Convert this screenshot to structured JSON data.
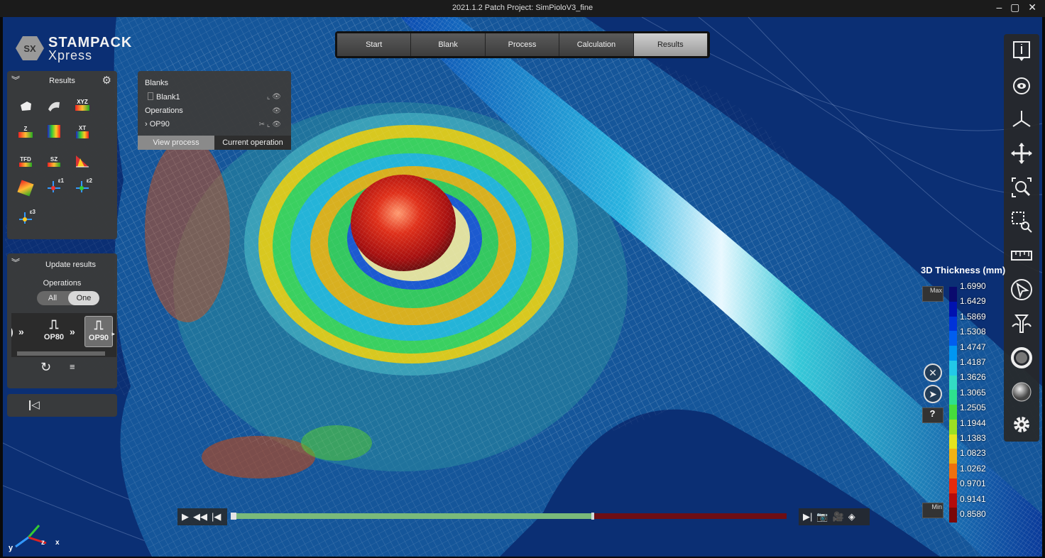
{
  "window": {
    "title": "2021.1.2 Patch  Project: SimPioloV3_fine",
    "controls": "– ▢ ✕"
  },
  "logo": {
    "badge": "SX",
    "line1": "STAMPACK",
    "line2": "Xpress"
  },
  "tabs": [
    {
      "label": "Start",
      "active": false
    },
    {
      "label": "Blank",
      "active": false
    },
    {
      "label": "Process",
      "active": false
    },
    {
      "label": "Calculation",
      "active": false
    },
    {
      "label": "Results",
      "active": true
    }
  ],
  "results_panel": {
    "title": "Results",
    "icons": [
      {
        "name": "blank-icon",
        "label": ""
      },
      {
        "name": "tool-icon",
        "label": ""
      },
      {
        "name": "xyz-displacement-icon",
        "label": "XYZ"
      },
      {
        "name": "z-displacement-icon",
        "label": "Z"
      },
      {
        "name": "thickness-icon",
        "label": ""
      },
      {
        "name": "xt-icon",
        "label": "XT"
      },
      {
        "name": "tfd-icon",
        "label": "TFD"
      },
      {
        "name": "sz-icon",
        "label": "SZ"
      },
      {
        "name": "fld-icon",
        "label": ""
      },
      {
        "name": "formability-icon",
        "label": ""
      },
      {
        "name": "strain-e1-icon",
        "label": "ε1"
      },
      {
        "name": "strain-e2-icon",
        "label": "ε2"
      },
      {
        "name": "strain-e3-icon",
        "label": "ε3"
      }
    ]
  },
  "update_panel": {
    "title": "Update results",
    "operations_label": "Operations",
    "toggle": {
      "all": "All",
      "one": "One",
      "selected": "One"
    },
    "ops": [
      {
        "label": "OP80",
        "selected": false
      },
      {
        "label": "OP90",
        "selected": true
      }
    ]
  },
  "tree": {
    "blanks_label": "Blanks",
    "blank_item": "Blank1",
    "operations_label": "Operations",
    "op_item": "OP90",
    "buttons": {
      "view_process": "View process",
      "current_operation": "Current operation"
    }
  },
  "toolbar": [
    "info-icon",
    "rotate-icon",
    "axes-view-icon",
    "pan-icon",
    "zoom-icon",
    "zoom-window-icon",
    "ruler-icon",
    "select-pointer-icon",
    "section-cut-icon",
    "wireframe-icon",
    "shaded-sphere-icon",
    "settings-gear-icon"
  ],
  "legend": {
    "title": "3D Thickness (mm)",
    "max_label": "Max",
    "min_label": "Min",
    "values": [
      "1.6990",
      "1.6429",
      "1.5869",
      "1.5308",
      "1.4747",
      "1.4187",
      "1.3626",
      "1.3065",
      "1.2505",
      "1.1944",
      "1.1383",
      "1.0823",
      "1.0262",
      "0.9701",
      "0.9141",
      "0.8580"
    ],
    "colors": [
      "#0a0a6e",
      "#0012b0",
      "#0033d9",
      "#005ef0",
      "#0096f2",
      "#22c9e8",
      "#33dcc4",
      "#2ee08e",
      "#46dc3c",
      "#9be023",
      "#e4e41e",
      "#f0b214",
      "#f0700e",
      "#e62a0c",
      "#b40c0c",
      "#7a0808"
    ]
  },
  "timeline": {
    "progress": 0.65
  },
  "axes": {
    "x": "x",
    "y": "y",
    "z": "z"
  }
}
